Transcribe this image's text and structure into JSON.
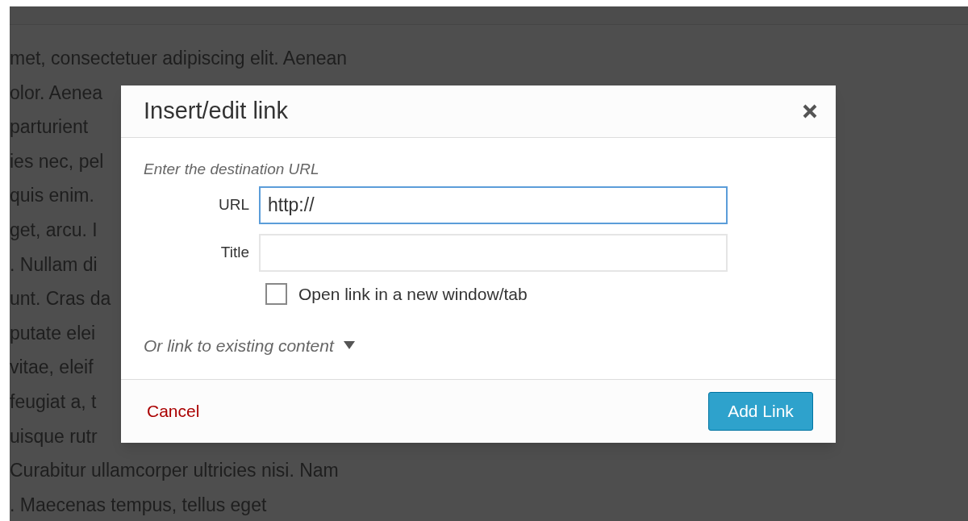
{
  "editor": {
    "lines": [
      "met, consectetuer adipiscing elit. Aenean",
      "olor. Aenea",
      "parturient",
      "ies nec, pel",
      "quis enim.",
      "get, arcu. I",
      ". Nullam di",
      "unt. Cras da",
      "putate elei",
      "vitae, eleif",
      "feugiat a, t",
      "uisque rutr",
      "Curabitur ullamcorper ultricies nisi. Nam",
      ". Maecenas tempus, tellus eget"
    ]
  },
  "dialog": {
    "title": "Insert/edit link",
    "intro": "Enter the destination URL",
    "fields": [
      {
        "label": "URL",
        "value": "http://",
        "focused": true
      },
      {
        "label": "Title",
        "focused": false
      }
    ],
    "checkbox": {
      "label": "Open link in a new window/tab",
      "checked": false
    },
    "existing_content": {
      "label": "Or link to existing content",
      "expanded": false
    },
    "cancel": "Cancel",
    "submit": "Add Link"
  }
}
